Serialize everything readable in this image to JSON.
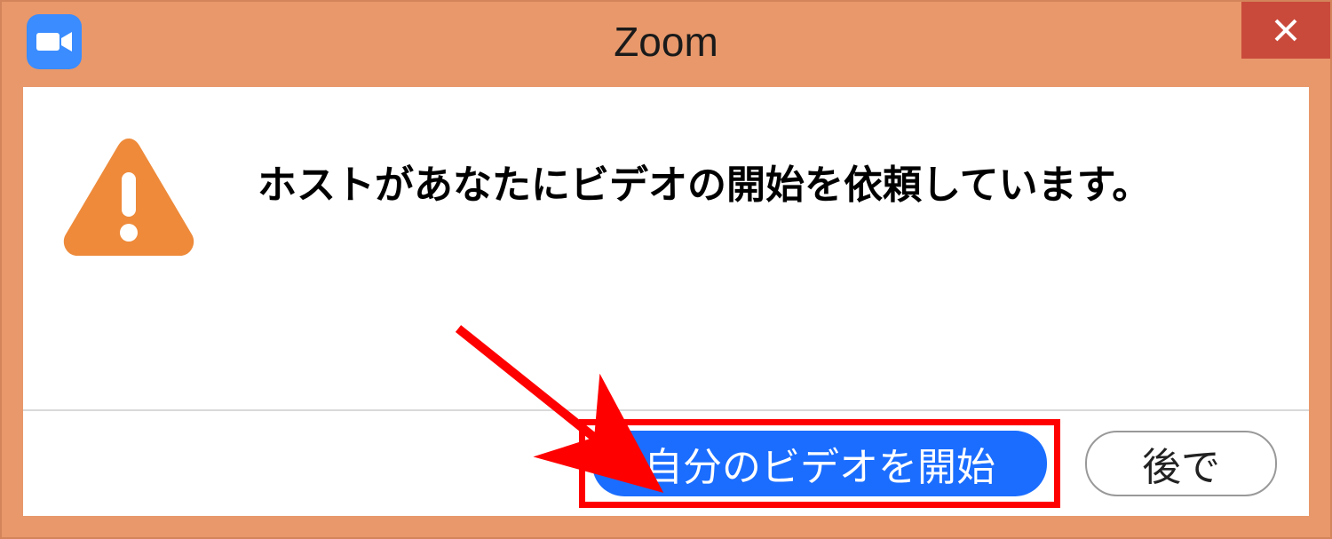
{
  "titlebar": {
    "title": "Zoom"
  },
  "dialog": {
    "message": "ホストがあなたにビデオの開始を依頼しています。"
  },
  "buttons": {
    "start_video": "自分のビデオを開始",
    "later": "後で"
  }
}
